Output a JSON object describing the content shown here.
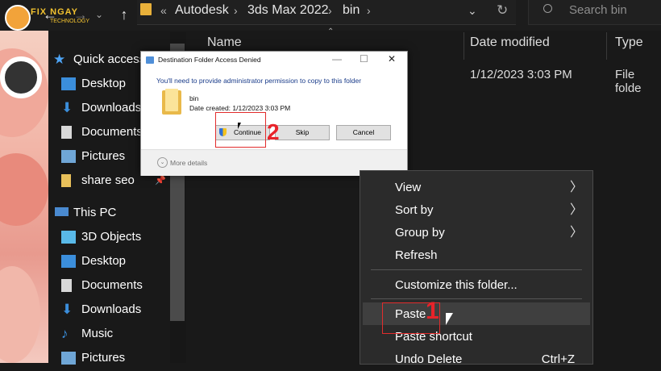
{
  "toolbar": {
    "back_glyph": "←",
    "forward_glyph": "→",
    "recent_glyph": "⌄",
    "up_glyph": "↑",
    "address": [
      "Autodesk",
      "3ds Max 2022",
      "bin"
    ],
    "breadcrumb_glyph": "«",
    "address_sep_glyph": "›",
    "dropdown_glyph": "⌄",
    "refresh_glyph": "↻",
    "search_placeholder": "Search bin"
  },
  "watermark": {
    "brand": "FIX NGAY",
    "subtitle": "TECHNOLOGY"
  },
  "columns": {
    "name": "Name",
    "date_modified": "Date modified",
    "type": "Type"
  },
  "file_row": {
    "date": "1/12/2023 3:03 PM",
    "type": "File folde"
  },
  "nav": {
    "quick_access": "Quick access",
    "pin_glyph": "📌",
    "items": [
      {
        "label": "Desktop",
        "icon": "desktop-icon"
      },
      {
        "label": "Downloads",
        "icon": "downloads-icon"
      },
      {
        "label": "Documents",
        "icon": "documents-icon"
      },
      {
        "label": "Pictures",
        "icon": "pictures-icon"
      },
      {
        "label": "share seo",
        "icon": "folder-icon"
      }
    ],
    "this_pc": "This PC",
    "pc_items": [
      {
        "label": "3D Objects",
        "icon": "3d-objects-icon"
      },
      {
        "label": "Desktop",
        "icon": "desktop-icon"
      },
      {
        "label": "Documents",
        "icon": "documents-icon"
      },
      {
        "label": "Downloads",
        "icon": "downloads-icon"
      },
      {
        "label": "Music",
        "icon": "music-icon"
      },
      {
        "label": "Pictures",
        "icon": "pictures-icon"
      }
    ]
  },
  "dialog": {
    "title": "Destination Folder Access Denied",
    "message": "You'll need to provide administrator permission to copy to this folder",
    "folder_name": "bin",
    "date_created": "Date created: 1/12/2023 3:03 PM",
    "continue_label": "Continue",
    "skip_label": "Skip",
    "cancel_label": "Cancel",
    "more_details": "More details",
    "more_glyph": "⌄",
    "minimize_glyph": "—",
    "maximize_glyph": "☐",
    "close_glyph": "✕"
  },
  "context_menu": {
    "view": "View",
    "sort_by": "Sort by",
    "group_by": "Group by",
    "refresh": "Refresh",
    "customize": "Customize this folder...",
    "paste": "Paste",
    "paste_shortcut": "Paste shortcut",
    "undo_delete": "Undo Delete",
    "undo_shortcut": "Ctrl+Z",
    "submenu_glyph": "〉"
  },
  "annotations": {
    "step1": "1",
    "step2": "2"
  },
  "colors": {
    "accent_red": "#e8232a",
    "explorer_bg": "#191919",
    "menu_bg": "#2b2b2b"
  }
}
